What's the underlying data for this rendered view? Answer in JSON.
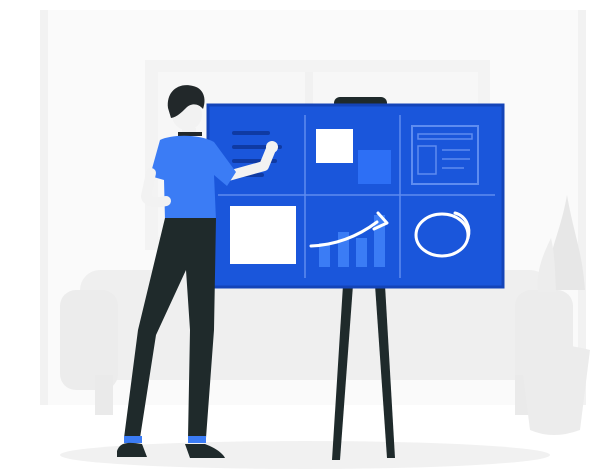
{
  "scene": {
    "subject": "person-at-planning-board",
    "background_tone": "#f4f4f4",
    "colors": {
      "board_blue": "#1a56db",
      "board_edge": "#1444b8",
      "board_line": "#5e8cf0",
      "sticky_white": "#ffffff",
      "sticky_blue": "#2d6ff5",
      "shirt_blue": "#3b7cf5",
      "pants_dark": "#1f2a2b",
      "hair_dark": "#22282a",
      "skin": "#f2f2f2",
      "stand_dark": "#1f2a2b",
      "furniture_gray": "#eeeeee",
      "furniture_light": "#f3f3f3",
      "floor_gray": "#f1f1f1"
    }
  }
}
